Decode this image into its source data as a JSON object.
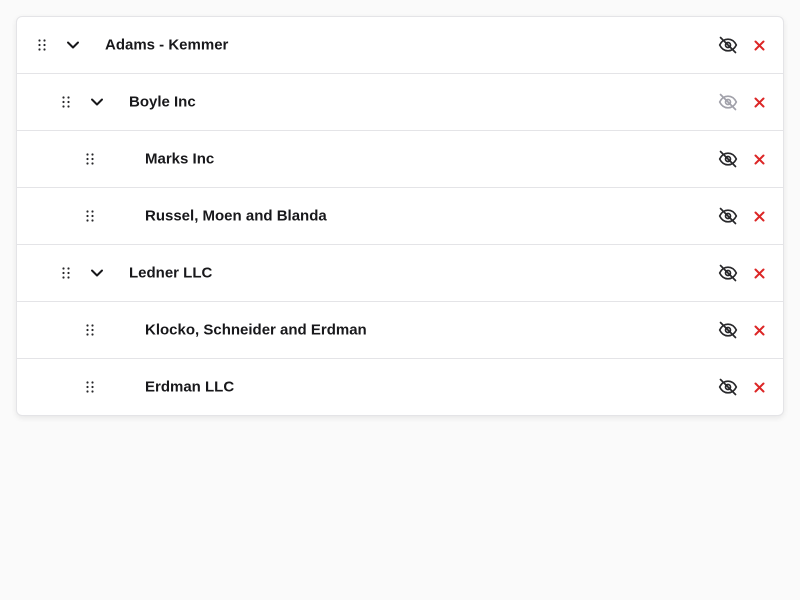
{
  "colors": {
    "text": "#18181b",
    "icon": "#27272a",
    "icon_muted": "#a1a1aa",
    "delete": "#dc2626",
    "border": "#e4e4e7"
  },
  "tree": {
    "rows": [
      {
        "label": "Adams - Kemmer",
        "level": 0,
        "expandable": true,
        "expanded": true,
        "visibility_icon": "eye-off-icon",
        "visibility_muted": false
      },
      {
        "label": "Boyle Inc",
        "level": 1,
        "expandable": true,
        "expanded": true,
        "visibility_icon": "eye-off-icon",
        "visibility_muted": true
      },
      {
        "label": "Marks Inc",
        "level": 2,
        "expandable": false,
        "visibility_icon": "eye-off-icon",
        "visibility_muted": false
      },
      {
        "label": "Russel, Moen and Blanda",
        "level": 2,
        "expandable": false,
        "visibility_icon": "eye-off-icon",
        "visibility_muted": false
      },
      {
        "label": "Ledner LLC",
        "level": 1,
        "expandable": true,
        "expanded": true,
        "visibility_icon": "eye-off-icon",
        "visibility_muted": false
      },
      {
        "label": "Klocko, Schneider and Erdman",
        "level": 2,
        "expandable": false,
        "visibility_icon": "eye-off-icon",
        "visibility_muted": false
      },
      {
        "label": "Erdman LLC",
        "level": 2,
        "expandable": false,
        "visibility_icon": "eye-off-icon",
        "visibility_muted": false
      }
    ]
  }
}
